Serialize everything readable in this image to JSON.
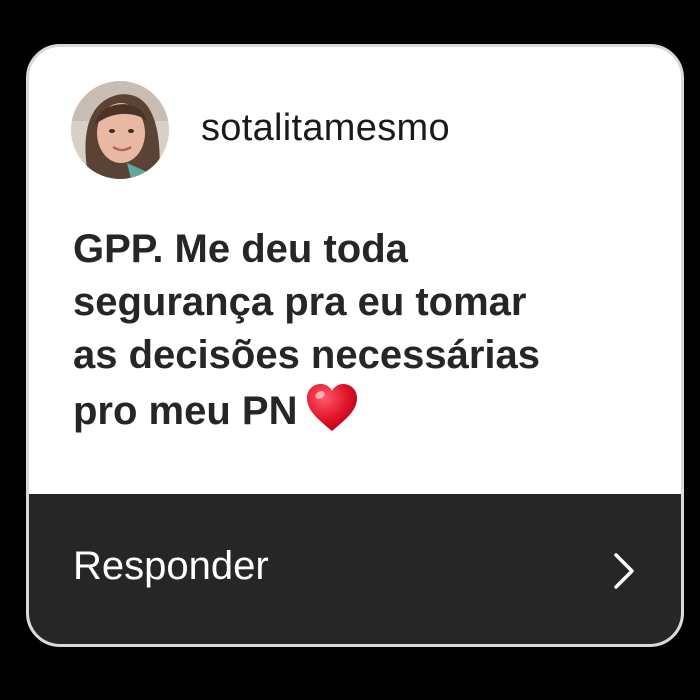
{
  "post": {
    "username": "sotalitamesmo",
    "message_lines": [
      "GPP. Me deu toda",
      "segurança pra eu tomar",
      "as decisões necessárias",
      "pro meu PN"
    ],
    "emoji": "heart-emoji"
  },
  "footer": {
    "reply_label": "Responder",
    "chevron_icon": "chevron-right-icon"
  },
  "colors": {
    "background": "#000000",
    "card": "#ffffff",
    "footer": "#262626",
    "text": "#262626",
    "heart": "#e0152a"
  }
}
